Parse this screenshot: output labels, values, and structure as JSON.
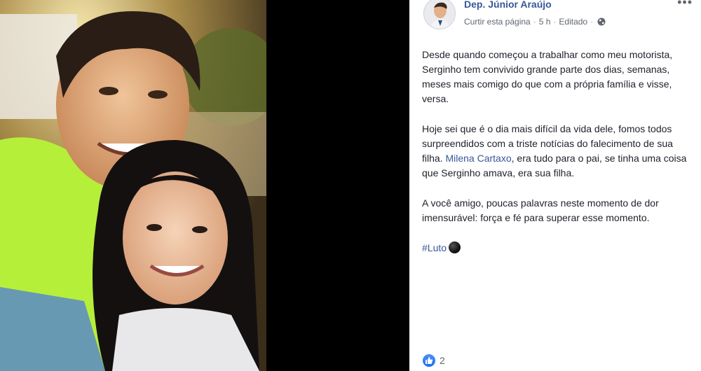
{
  "post": {
    "author": "Dep. Júnior Araújo",
    "like_page": "Curtir esta página",
    "time": "5 h",
    "edited": "Editado",
    "separator": "·",
    "more": "•••",
    "paragraph1": "Desde quando começou a trabalhar como meu motorista, Serginho tem convivido grande parte dos dias, semanas, meses mais comigo do que com a própria família e visse, versa.",
    "paragraph2_a": "Hoje sei que é o dia mais difícil da vida dele, fomos todos surpreendidos com a triste notícias do falecimento de sua filha. ",
    "paragraph2_mention": "Milena Cartaxo",
    "paragraph2_b": ", era tudo para o pai, se tinha uma coisa que Serginho amava, era sua filha.",
    "paragraph3": "A você amigo, poucas palavras neste momento de dor imensurável: força e fé para superar esse momento.",
    "hashtag": "#Luto",
    "reaction_count": "2"
  },
  "colors": {
    "link": "#365899",
    "text": "#1d2129",
    "meta": "#606770",
    "like_blue": "#1a6ef5"
  },
  "icons": [
    "globe-icon",
    "more-options-icon",
    "like-reaction-icon",
    "black-circle-emoji"
  ]
}
